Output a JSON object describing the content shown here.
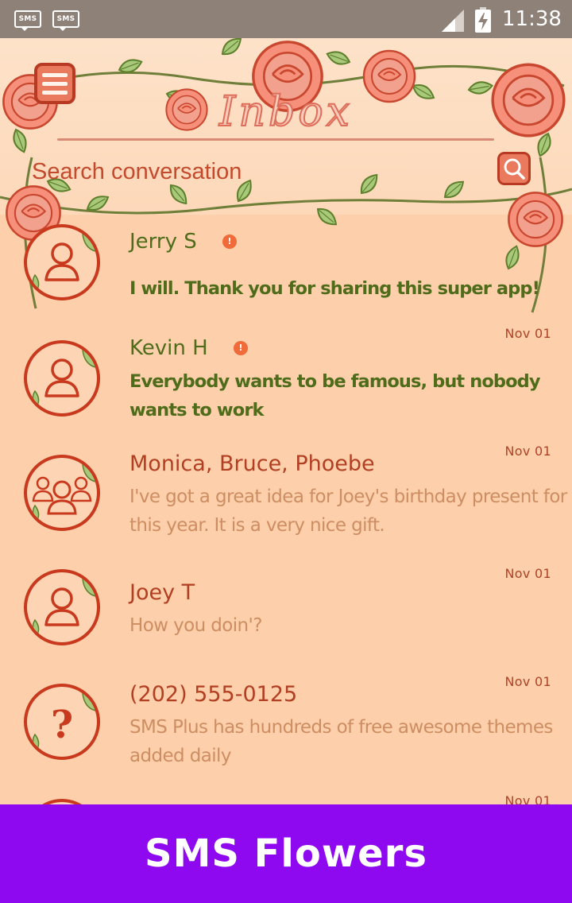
{
  "status_bar": {
    "notifications": [
      "SMS",
      "SMS"
    ],
    "time": "11:38",
    "icons": [
      "signal-icon",
      "battery-charging-icon"
    ]
  },
  "header": {
    "title": "Inbox",
    "menu_icon": "hamburger-menu-icon",
    "search": {
      "placeholder": "Search conversation",
      "icon": "search-icon"
    }
  },
  "conversations": [
    {
      "name": "Jerry S",
      "snippet": "I will. Thank you for sharing this super app!",
      "date": "",
      "unread": true,
      "avatar": "person-icon"
    },
    {
      "name": "Kevin H",
      "snippet": "Everybody wants to be famous, but nobody wants to work",
      "date": "Nov 01",
      "unread": true,
      "avatar": "person-icon"
    },
    {
      "name": "Monica, Bruce, Phoebe",
      "snippet": "I've got a great idea for Joey's birthday present for this year. It is a very nice gift.",
      "date": "Nov 01",
      "unread": false,
      "avatar": "group-icon"
    },
    {
      "name": "Joey T",
      "snippet": "How you doin'?",
      "date": "Nov 01",
      "unread": false,
      "avatar": "person-icon"
    },
    {
      "name": "(202) 555-0125",
      "snippet": "SMS Plus has hundreds of free awesome themes added daily",
      "date": "Nov 01",
      "unread": false,
      "avatar": "unknown-contact-icon"
    },
    {
      "name": "",
      "snippet": "",
      "date": "Nov 01",
      "unread": false,
      "avatar": "person-icon"
    }
  ],
  "banner": {
    "text": "SMS Flowers"
  },
  "colors": {
    "background": "#fdcfaa",
    "accent": "#c8391e",
    "unread_text": "#4f6c1b",
    "read_name": "#b33f23",
    "read_snippet": "#cd8e63",
    "banner": "#8e09f0",
    "status_bar": "#8e8178"
  }
}
